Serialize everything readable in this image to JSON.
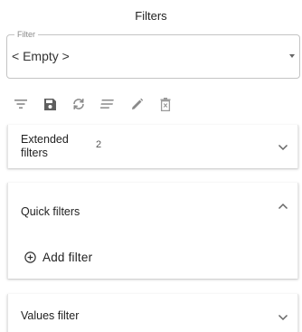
{
  "panel": {
    "title": "Filters"
  },
  "filter_select": {
    "legend": "Filter",
    "value": "< Empty >",
    "icon": "caret-down-icon"
  },
  "toolbar": {
    "icons": [
      "filter-lines-icon",
      "save-icon",
      "sync-icon",
      "list-icon",
      "pencil-icon",
      "trash-icon"
    ]
  },
  "sections": {
    "extended": {
      "label": "Extended filters",
      "count": "2",
      "expanded": false
    },
    "quick": {
      "label": "Quick filters",
      "expanded": true,
      "add_label": "Add filter"
    },
    "values": {
      "label": "Values filter",
      "expanded": false
    }
  }
}
